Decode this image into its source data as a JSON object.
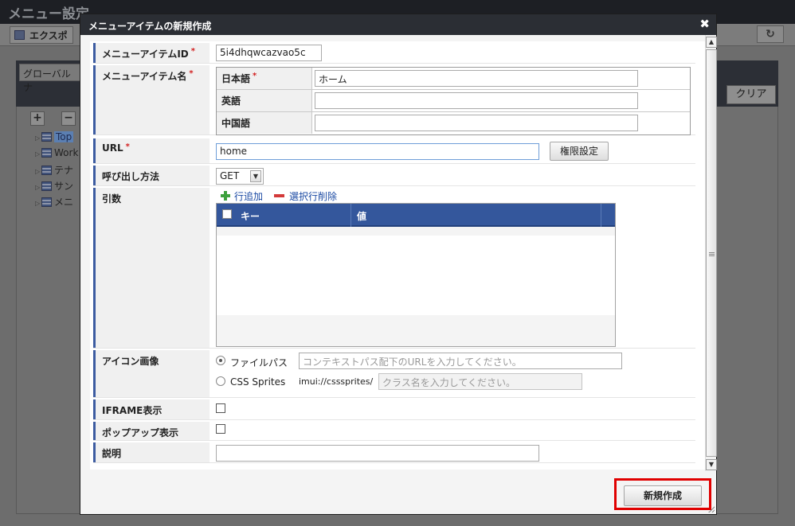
{
  "background": {
    "page_title": "メニュー設定",
    "export_label": "エクスポ",
    "global_tab": "グローバルナ",
    "clear_button": "クリア",
    "tree_add": "+",
    "tree_remove": "−",
    "tree_items": [
      "Top",
      "Work",
      "テナ",
      "サン",
      "メニ"
    ]
  },
  "dialog": {
    "title": "メニューアイテムの新規作成",
    "close_label": "✖",
    "required_mark": "*",
    "fields": {
      "item_id": {
        "label": "メニューアイテムID",
        "value": "5i4dhqwcazvao5c"
      },
      "item_name": {
        "label": "メニューアイテム名",
        "langs": [
          {
            "label": "日本語",
            "value": "ホーム",
            "required": true
          },
          {
            "label": "英語",
            "value": "",
            "required": false
          },
          {
            "label": "中国語",
            "value": "",
            "required": false
          }
        ]
      },
      "url": {
        "label": "URL",
        "value": "home",
        "permission_button": "権限設定"
      },
      "call_method": {
        "label": "呼び出し方法",
        "selected": "GET"
      },
      "args": {
        "label": "引数",
        "add_row": "行追加",
        "delete_row": "選択行削除",
        "col_key": "キー",
        "col_value": "値"
      },
      "icon_image": {
        "label": "アイコン画像",
        "option_file": "ファイルパス",
        "file_placeholder": "コンテキストパス配下のURLを入力してください。",
        "option_css": "CSS Sprites",
        "css_prefix": "imui://csssprites/",
        "css_placeholder": "クラス名を入力してください。",
        "selected": "file"
      },
      "iframe": {
        "label": "IFRAME表示",
        "checked": false
      },
      "popup": {
        "label": "ポップアップ表示",
        "checked": false
      },
      "description": {
        "label": "説明",
        "value": ""
      }
    },
    "create_button": "新規作成"
  }
}
